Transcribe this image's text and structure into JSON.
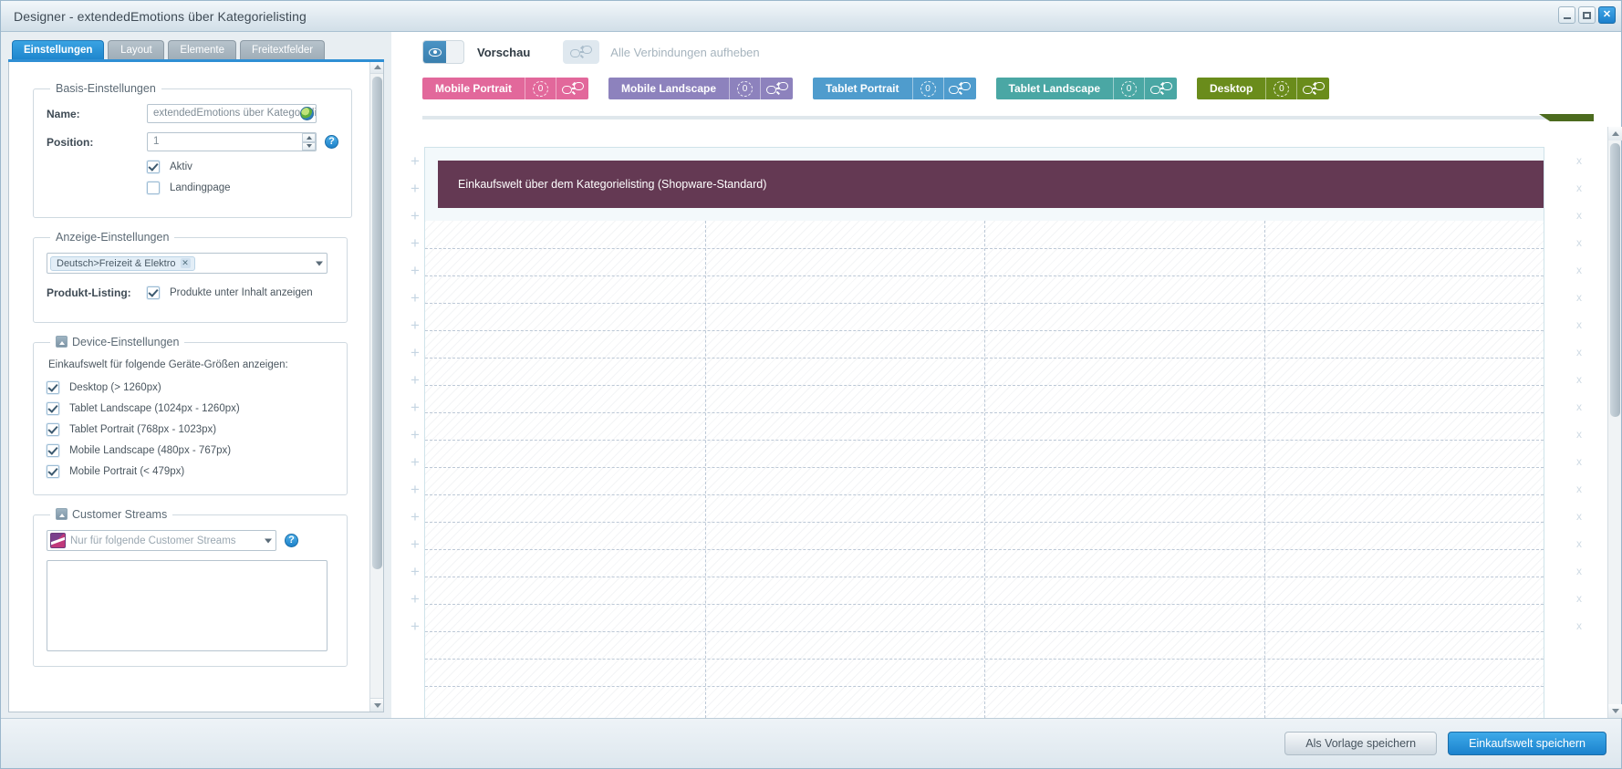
{
  "window": {
    "title": "Designer - extendedEmotions über Kategorielisting",
    "controls": {
      "minimize": "_",
      "maximize": "□",
      "close": "✕"
    }
  },
  "tabs": [
    {
      "label": "Einstellungen",
      "active": true
    },
    {
      "label": "Layout",
      "active": false
    },
    {
      "label": "Elemente",
      "active": false
    },
    {
      "label": "Freitextfelder",
      "active": false
    }
  ],
  "settings_panel": {
    "basis": {
      "legend": "Basis-Einstellungen",
      "name_label": "Name:",
      "name_value": "extendedEmotions über Kategorielisting",
      "position_label": "Position:",
      "position_value": "1",
      "help": "?",
      "aktiv_label": "Aktiv",
      "aktiv_checked": true,
      "landingpage_label": "Landingpage",
      "landingpage_checked": false
    },
    "anzeige": {
      "legend": "Anzeige-Einstellungen",
      "category_tag": "Deutsch>Freizeit & Elektro",
      "tag_remove": "✕",
      "produkt_listing_label": "Produkt-Listing:",
      "produkt_listing_checkbox_label": "Produkte unter Inhalt anzeigen",
      "produkt_listing_checked": true
    },
    "device": {
      "legend": "Device-Einstellungen",
      "hint": "Einkaufswelt für folgende Geräte-Größen anzeigen:",
      "items": [
        {
          "label": "Desktop (> 1260px)",
          "checked": true
        },
        {
          "label": "Tablet Landscape (1024px - 1260px)",
          "checked": true
        },
        {
          "label": "Tablet Portrait (768px - 1023px)",
          "checked": true
        },
        {
          "label": "Mobile Landscape (480px - 767px)",
          "checked": true
        },
        {
          "label": "Mobile Portrait (< 479px)",
          "checked": true
        }
      ]
    },
    "customer_streams": {
      "legend": "Customer Streams",
      "placeholder": "Nur für folgende Customer Streams",
      "help": "?"
    }
  },
  "toolbar": {
    "preview_label": "Vorschau",
    "preview_enabled": true,
    "unlink_all_label": "Alle Verbindungen aufheben",
    "unlink_all_enabled": false
  },
  "devices": [
    {
      "name": "Mobile Portrait",
      "count": "0",
      "color": "#e2689b",
      "active": false
    },
    {
      "name": "Mobile Landscape",
      "count": "0",
      "color": "#8d82bd",
      "active": false
    },
    {
      "name": "Tablet Portrait",
      "count": "0",
      "color": "#4f9ccd",
      "active": false
    },
    {
      "name": "Tablet Landscape",
      "count": "0",
      "color": "#4aa7a4",
      "active": false
    },
    {
      "name": "Desktop",
      "count": "0",
      "color": "#6a8c1b",
      "active": true
    }
  ],
  "canvas": {
    "banner_title": "Einkaufswelt über dem Kategorielisting (Shopware-Standard)",
    "banner_color": "#643953",
    "add_row_symbol": "+",
    "delete_row_symbol": "x",
    "add_row_count": 18,
    "delete_row_count": 18
  },
  "footer": {
    "save_template_label": "Als Vorlage speichern",
    "save_label": "Einkaufswelt speichern"
  }
}
